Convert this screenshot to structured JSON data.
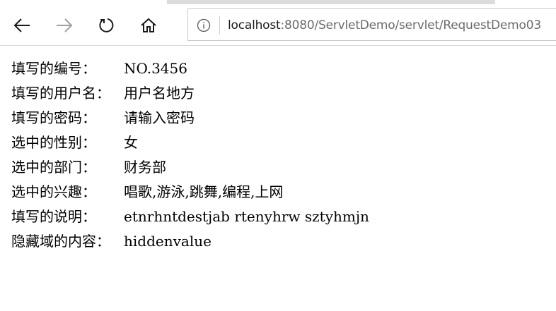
{
  "browser": {
    "url_host": "localhost",
    "url_rest": ":8080/ServletDemo/servlet/RequestDemo03",
    "icons": {
      "back": "back-arrow-icon",
      "forward": "forward-arrow-icon",
      "refresh": "refresh-icon",
      "home": "home-icon",
      "info": "info-icon"
    }
  },
  "fields": [
    {
      "label": "填写的编号：",
      "value": "NO.3456"
    },
    {
      "label": "填写的用户名：",
      "value": "用户名地方"
    },
    {
      "label": "填写的密码：",
      "value": "请输入密码"
    },
    {
      "label": "选中的性别：",
      "value": "女"
    },
    {
      "label": "选中的部门：",
      "value": "财务部"
    },
    {
      "label": "选中的兴趣：",
      "value": "唱歌,游泳,跳舞,编程,上网"
    },
    {
      "label": "填写的说明：",
      "value": "etnrhntdestjab rtenyhrw sztyhmjn"
    },
    {
      "label": "隐藏域的内容：",
      "value": "hiddenvalue"
    }
  ]
}
